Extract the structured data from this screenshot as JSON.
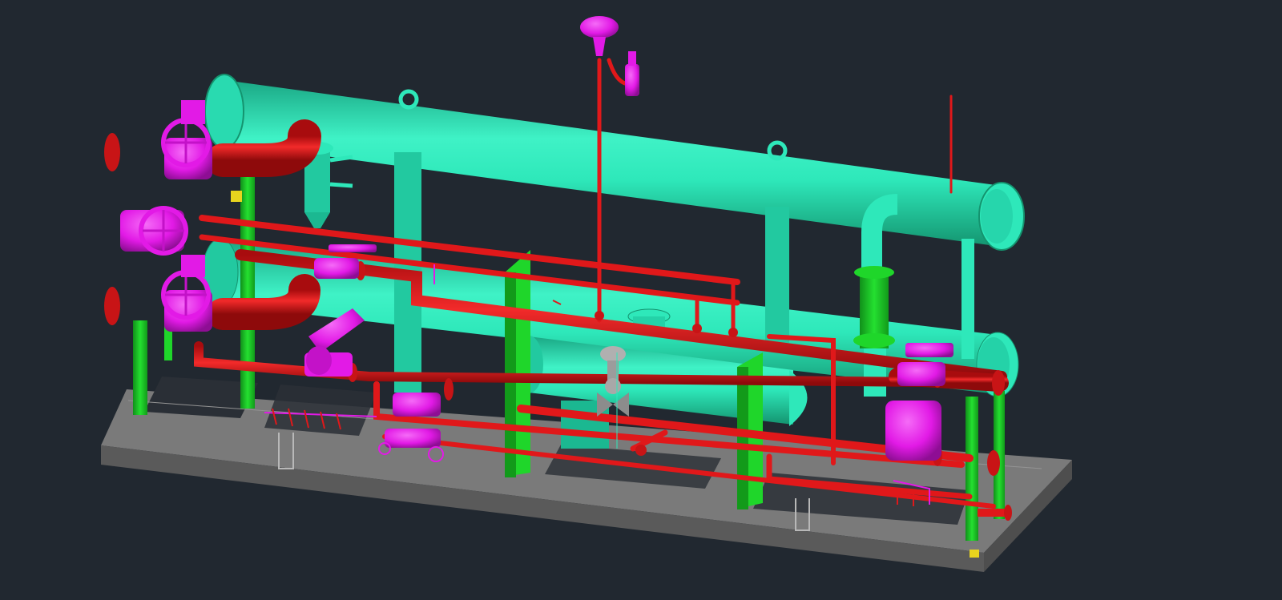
{
  "viewport": {
    "background": "#212830",
    "model_type": "3D piping skid"
  },
  "colors": {
    "vessel": "#2EE8BA",
    "vessel_dark": "#16B08A",
    "pipe": "#E0181A",
    "pipe_dark": "#9E0A0C",
    "valve": "#E21AE6",
    "valve_dark": "#A010A6",
    "steel": "#1FD62A",
    "steel_dark": "#129A1A",
    "base": "#7E7E7E",
    "base_dark": "#5C5C5C",
    "grey_valve": "#9C9C9C",
    "yellow": "#E8D41E"
  },
  "icons": [
    "globe-valve-icon",
    "control-valve-icon",
    "relief-valve-icon",
    "vent-cap-icon"
  ]
}
